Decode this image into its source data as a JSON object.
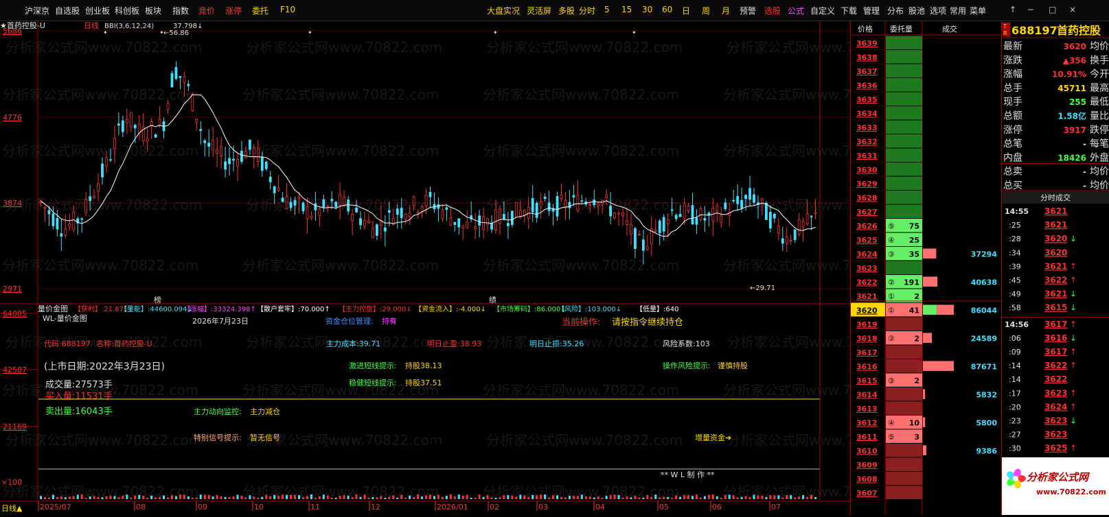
{
  "menu": {
    "left_items": [
      {
        "label": "沪深京",
        "color": "#e0e0e0"
      },
      {
        "label": "自选股",
        "color": "#e0e0e0"
      },
      {
        "label": "创业板",
        "color": "#e0e0e0"
      },
      {
        "label": "科创板",
        "color": "#e0e0e0"
      },
      {
        "label": "板块",
        "color": "#e0e0e0"
      },
      {
        "label": "指数",
        "color": "#e0e0e0"
      },
      {
        "label": "竞价",
        "color": "#ff3030"
      },
      {
        "label": "涨停",
        "color": "#ff3030"
      },
      {
        "label": "委托",
        "color": "#ffd700"
      },
      {
        "label": "F10",
        "color": "#ffd700"
      }
    ],
    "right_items": [
      {
        "label": "大盘实况",
        "color": "#ffd700"
      },
      {
        "label": "灵活屏",
        "color": "#ffd700"
      },
      {
        "label": "多股",
        "color": "#ffd700"
      },
      {
        "label": "分时",
        "color": "#ffd700"
      },
      {
        "label": "5",
        "color": "#ffd700"
      },
      {
        "label": "15",
        "color": "#ffd700"
      },
      {
        "label": "30",
        "color": "#ffd700"
      },
      {
        "label": "60",
        "color": "#ffd700"
      },
      {
        "label": "日",
        "color": "#ffd700"
      },
      {
        "label": "周",
        "color": "#ffd700"
      },
      {
        "label": "月",
        "color": "#ffd700"
      },
      {
        "label": "预警",
        "color": "#e0e0e0"
      },
      {
        "label": "选股",
        "color": "#ff3030"
      },
      {
        "label": "公式",
        "color": "#ff40ff"
      },
      {
        "label": "自定义",
        "color": "#e0e0e0"
      },
      {
        "label": "下载",
        "color": "#e0e0e0"
      },
      {
        "label": "管理",
        "color": "#e0e0e0"
      },
      {
        "label": "分布",
        "color": "#e0e0e0"
      },
      {
        "label": "股池",
        "color": "#e0e0e0"
      },
      {
        "label": "选项",
        "color": "#e0e0e0"
      },
      {
        "label": "常用",
        "color": "#e0e0e0"
      },
      {
        "label": "菜单",
        "color": "#e0e0e0"
      }
    ],
    "window_controls": [
      "↑",
      "−",
      "□",
      "×"
    ]
  },
  "chart": {
    "title": "首药控股-U",
    "period_label": "日线",
    "indicator": "BBI(3,6,12,24)",
    "indicator_value": "37.798",
    "indicator_arrow": "↓",
    "high_label": "56.86",
    "low_label": "29.71",
    "price_axis": [
      "5686",
      "4776",
      "3874",
      "2971"
    ],
    "volume_axis": [
      "64005",
      "42587",
      "21169"
    ],
    "volume_axis_unit": "×100",
    "bottom_left_label": "日线",
    "date_axis": [
      "2025/07",
      "08",
      "09",
      "10",
      "11",
      "12",
      "2026/01",
      "02",
      "03",
      "04",
      "05",
      "06",
      "07"
    ],
    "markers": [
      "榜",
      "绩"
    ],
    "watermark": "分析家公式网www.70822.com"
  },
  "indicator_bar": {
    "name": "量价金图",
    "items": [
      {
        "label": "【获利】",
        "value": "21.875",
        "arrow": "↓",
        "color": "#ff3030"
      },
      {
        "label": "【量能】",
        "value": "44600.094",
        "arrow": "↓",
        "color": "#40e0ff"
      },
      {
        "label": "【涨幅】",
        "value": "33324.398",
        "arrow": "↑",
        "color": "#ff40ff"
      },
      {
        "label": "【散户套牢】",
        "value": "70.000",
        "arrow": "↑",
        "color": "#ffffff"
      },
      {
        "label": "【主力控盘】",
        "value": "29.000",
        "arrow": "↓",
        "color": "#ff3030"
      },
      {
        "label": "【资金流入】",
        "value": "-4.000",
        "arrow": "↓",
        "color": "#ffd700"
      },
      {
        "label": "【市场筹码】",
        "value": "86.000",
        "arrow": "↓",
        "color": "#40ff40"
      },
      {
        "label": "【风险】",
        "value": "103.000",
        "arrow": "↓",
        "color": "#40e0ff"
      },
      {
        "label": "【低量】",
        "value": "640",
        "arrow": "",
        "color": "#ffffff"
      }
    ]
  },
  "volume_panel": {
    "formula_name": "WL-量价金图",
    "date": "2026年7月23日",
    "fund_position_label": "资金仓位管理:",
    "fund_position_value": "持有",
    "current_op_label": "当前操作:",
    "current_op_value": "请按指令继续持仓",
    "code_label": "代码:",
    "code_value": "688197",
    "name_label": "名称:",
    "name_value": "首药控股-U",
    "main_cost_label": "主力成本:",
    "main_cost_value": "39.71",
    "tomorrow_profit_label": "明日止盈:",
    "tomorrow_profit_value": "38.93",
    "tomorrow_stop_label": "明日止损:",
    "tomorrow_stop_value": "35.26",
    "risk_label": "风险系数:",
    "risk_value": "103",
    "listing_date": "(上市日期:2022年3月23日)",
    "aggressive_label": "激进短线提示:",
    "aggressive_value": "持股",
    "aggressive_num": "38.13",
    "operation_risk_label": "操作风险提示:",
    "operation_risk_value": "谨慎持股",
    "volume_label": "成交量:",
    "volume_value": "27573手",
    "steady_label": "稳健短线提示:",
    "steady_value": "持股",
    "steady_num": "37.51",
    "buy_label": "买入量:",
    "buy_value": "11531手",
    "sell_label": "卖出量:",
    "sell_value": "16043手",
    "main_monitor_label": "主力动向监控:",
    "main_monitor_value": "主力减仓",
    "special_signal_label": "特别信号提示:",
    "special_signal_value": "暂无信号",
    "increment_label": "增量资金",
    "author": "**  W L  制  作  **"
  },
  "orderbook": {
    "headers": [
      "价格",
      "委托量",
      "成交"
    ],
    "current_price": "3620",
    "rows": [
      {
        "price": "3639",
        "rank": "",
        "qty": "",
        "deal": "",
        "side": "ask",
        "bar": 0
      },
      {
        "price": "3638",
        "rank": "",
        "qty": "",
        "deal": "",
        "side": "ask",
        "bar": 0
      },
      {
        "price": "3637",
        "rank": "",
        "qty": "",
        "deal": "",
        "side": "ask",
        "bar": 0
      },
      {
        "price": "3636",
        "rank": "",
        "qty": "",
        "deal": "",
        "side": "ask",
        "bar": 0
      },
      {
        "price": "3635",
        "rank": "",
        "qty": "",
        "deal": "",
        "side": "ask",
        "bar": 0
      },
      {
        "price": "3634",
        "rank": "",
        "qty": "",
        "deal": "",
        "side": "ask",
        "bar": 0
      },
      {
        "price": "3633",
        "rank": "",
        "qty": "",
        "deal": "",
        "side": "ask",
        "bar": 0
      },
      {
        "price": "3632",
        "rank": "",
        "qty": "",
        "deal": "",
        "side": "ask",
        "bar": 0
      },
      {
        "price": "3631",
        "rank": "",
        "qty": "",
        "deal": "",
        "side": "ask",
        "bar": 0
      },
      {
        "price": "3630",
        "rank": "",
        "qty": "",
        "deal": "",
        "side": "ask",
        "bar": 0
      },
      {
        "price": "3629",
        "rank": "",
        "qty": "",
        "deal": "",
        "side": "ask",
        "bar": 0
      },
      {
        "price": "3628",
        "rank": "",
        "qty": "",
        "deal": "",
        "side": "ask",
        "bar": 0
      },
      {
        "price": "3627",
        "rank": "",
        "qty": "",
        "deal": "",
        "side": "ask",
        "bar": 0
      },
      {
        "price": "3626",
        "rank": "⑤",
        "qty": "75",
        "deal": "",
        "side": "ask",
        "bar": 0
      },
      {
        "price": "3625",
        "rank": "④",
        "qty": "25",
        "deal": "",
        "side": "ask",
        "bar": 0
      },
      {
        "price": "3624",
        "rank": "③",
        "qty": "35",
        "deal": "37294",
        "side": "ask",
        "bar": 0.43
      },
      {
        "price": "3623",
        "rank": "",
        "qty": "",
        "deal": "",
        "side": "ask",
        "bar": 0
      },
      {
        "price": "3622",
        "rank": "②",
        "qty": "191",
        "deal": "40638",
        "side": "ask",
        "bar": 0.47
      },
      {
        "price": "3621",
        "rank": "①",
        "qty": "2",
        "deal": "",
        "side": "ask",
        "bar": 0
      },
      {
        "price": "3620",
        "rank": "①",
        "qty": "41",
        "deal": "86044",
        "side": "cur",
        "bar": 1.0
      },
      {
        "price": "3619",
        "rank": "",
        "qty": "",
        "deal": "",
        "side": "bid",
        "bar": 0
      },
      {
        "price": "3618",
        "rank": "②",
        "qty": "2",
        "deal": "24589",
        "side": "bid",
        "bar": 0.29
      },
      {
        "price": "3617",
        "rank": "",
        "qty": "",
        "deal": "",
        "side": "bid",
        "bar": 0
      },
      {
        "price": "3616",
        "rank": "",
        "qty": "",
        "deal": "87671",
        "side": "bid",
        "bar": 1.0
      },
      {
        "price": "3615",
        "rank": "③",
        "qty": "2",
        "deal": "",
        "side": "bid",
        "bar": 0
      },
      {
        "price": "3614",
        "rank": "",
        "qty": "",
        "deal": "5832",
        "side": "bid",
        "bar": 0.07
      },
      {
        "price": "3613",
        "rank": "",
        "qty": "",
        "deal": "",
        "side": "bid",
        "bar": 0
      },
      {
        "price": "3612",
        "rank": "④",
        "qty": "10",
        "deal": "5800",
        "side": "bid",
        "bar": 0.07
      },
      {
        "price": "3611",
        "rank": "⑤",
        "qty": "3",
        "deal": "",
        "side": "bid",
        "bar": 0
      },
      {
        "price": "3610",
        "rank": "",
        "qty": "",
        "deal": "9386",
        "side": "bid",
        "bar": 0.11
      },
      {
        "price": "3609",
        "rank": "",
        "qty": "",
        "deal": "",
        "side": "bid",
        "bar": 0
      },
      {
        "price": "3608",
        "rank": "",
        "qty": "",
        "deal": "",
        "side": "bid",
        "bar": 0
      },
      {
        "price": "3607",
        "rank": "",
        "qty": "",
        "deal": "",
        "side": "bid",
        "bar": 0
      }
    ]
  },
  "quote": {
    "badge": "TR",
    "code": "688197",
    "name": "首药控股",
    "stats": [
      {
        "l1": "最新",
        "v1": "3620",
        "c1": "#ff3030",
        "l2": "均价"
      },
      {
        "l1": "涨跌",
        "v1": "▲356",
        "c1": "#ff3030",
        "l2": "换手"
      },
      {
        "l1": "涨幅",
        "v1": "10.91%",
        "c1": "#ff3030",
        "l2": "今开"
      },
      {
        "l1": "总手",
        "v1": "45711",
        "c1": "#ffd700",
        "l2": "最高"
      },
      {
        "l1": "现手",
        "v1": "255",
        "c1": "#40ff40",
        "l2": "最低"
      },
      {
        "l1": "总额",
        "v1": "1.58亿",
        "c1": "#40e0ff",
        "l2": "量比"
      },
      {
        "l1": "涨停",
        "v1": "3917",
        "c1": "#ff3030",
        "l2": "跌停"
      },
      {
        "l1": "总笔",
        "v1": "-",
        "c1": "#e0e0e0",
        "l2": "每笔"
      },
      {
        "l1": "内盘",
        "v1": "18426",
        "c1": "#40ff40",
        "l2": "外盘"
      },
      {
        "l1": "总卖",
        "v1": "-",
        "c1": "#e0e0e0",
        "l2": "均价"
      },
      {
        "l1": "总买",
        "v1": "-",
        "c1": "#e0e0e0",
        "l2": "均价"
      }
    ],
    "ticks_title": "分时成交",
    "ticks": [
      {
        "time": "14:55",
        "price": "3621",
        "arrow": ""
      },
      {
        "time": ":25",
        "price": "3621",
        "arrow": ""
      },
      {
        "time": ":28",
        "price": "3620",
        "arrow": "↓"
      },
      {
        "time": ":34",
        "price": "3620",
        "arrow": ""
      },
      {
        "time": ":39",
        "price": "3621",
        "arrow": "↑"
      },
      {
        "time": ":45",
        "price": "3622",
        "arrow": "↑"
      },
      {
        "time": ":49",
        "price": "3621",
        "arrow": "↓"
      },
      {
        "time": ":58",
        "price": "3615",
        "arrow": "↓"
      },
      {
        "time": "14:56",
        "price": "3617",
        "arrow": "↑"
      },
      {
        "time": ":06",
        "price": "3616",
        "arrow": "↓"
      },
      {
        "time": ":09",
        "price": "3617",
        "arrow": "↑"
      },
      {
        "time": ":14",
        "price": "3622",
        "arrow": "↑"
      },
      {
        "time": ":14",
        "price": "3622",
        "arrow": ""
      },
      {
        "time": ":17",
        "price": "3623",
        "arrow": "↑"
      },
      {
        "time": ":20",
        "price": "3624",
        "arrow": "↑"
      },
      {
        "time": ":23",
        "price": "3623",
        "arrow": "↓"
      },
      {
        "time": ":27",
        "price": "3623",
        "arrow": ""
      },
      {
        "time": ":30",
        "price": "3625",
        "arrow": "↑"
      },
      {
        "time": ":34",
        "price": "3626",
        "arrow": "↑"
      }
    ],
    "logo_text": "分析家公式网",
    "logo_url": "www.70822.com"
  }
}
